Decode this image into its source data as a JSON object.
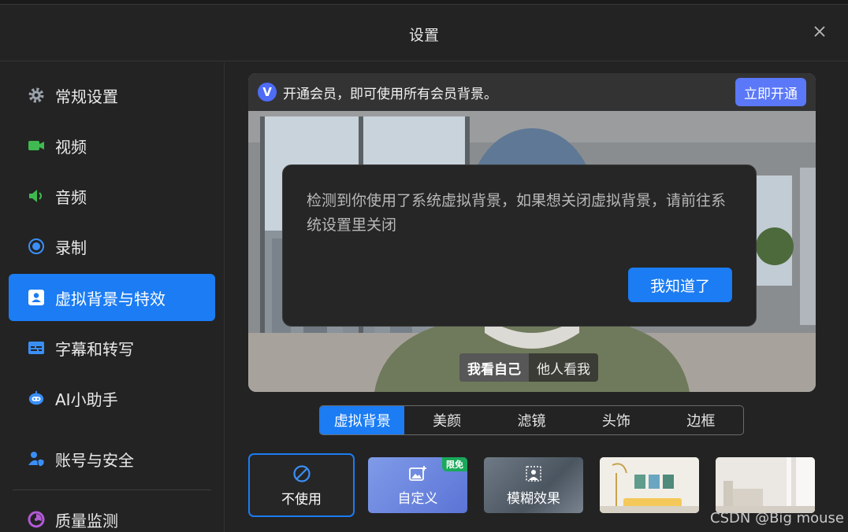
{
  "window": {
    "title": "设置"
  },
  "sidebar": {
    "items": [
      {
        "label": "常规设置",
        "icon": "gear-icon"
      },
      {
        "label": "视频",
        "icon": "camera-icon"
      },
      {
        "label": "音频",
        "icon": "speaker-icon"
      },
      {
        "label": "录制",
        "icon": "record-icon"
      },
      {
        "label": "虚拟背景与特效",
        "icon": "portrait-icon",
        "active": true
      },
      {
        "label": "字幕和转写",
        "icon": "caption-icon"
      },
      {
        "label": "AI小助手",
        "icon": "robot-icon"
      },
      {
        "label": "账号与安全",
        "icon": "user-shield-icon"
      },
      {
        "label": "质量监测",
        "icon": "monitor-icon"
      }
    ]
  },
  "preview": {
    "vip_logo": "V",
    "vip_text": "开通会员，即可使用所有会员背景。",
    "vip_button": "立即开通",
    "view_self": "我看自己",
    "view_others": "他人看我"
  },
  "dialog": {
    "message": "检测到你使用了系统虚拟背景，如果想关闭虚拟背景，请前往系统设置里关闭",
    "confirm": "我知道了"
  },
  "tabs": [
    "虚拟背景",
    "美颜",
    "滤镜",
    "头饰",
    "边框"
  ],
  "backgrounds": {
    "none_label": "不使用",
    "custom_label": "自定义",
    "custom_badge": "限免",
    "blur_label": "模糊效果"
  },
  "watermark": "CSDN @Big mouse",
  "colors": {
    "accent": "#1b7cf3",
    "vip": "#5a78f7",
    "badge": "#1aa95a",
    "background": "#232323"
  }
}
